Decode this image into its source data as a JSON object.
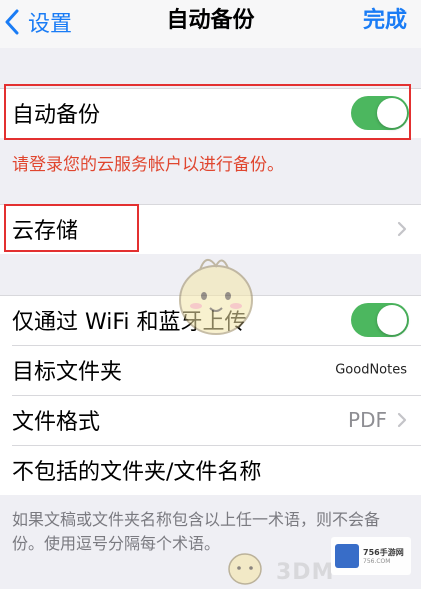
{
  "navbar": {
    "back_label": "设置",
    "title": "自动备份",
    "done_label": "完成"
  },
  "auto_backup": {
    "label": "自动备份",
    "toggle_on": true,
    "error_message": "请登录您的云服务帐户以进行备份。"
  },
  "cloud_storage": {
    "label": "云存储"
  },
  "options": {
    "wifi_bluetooth_label": "仅通过 WiFi 和蓝牙上传",
    "wifi_bluetooth_on": true,
    "target_folder_label": "目标文件夹",
    "target_folder_value": "GoodNotes",
    "file_format_label": "文件格式",
    "file_format_value": "PDF",
    "excluded_label": "不包括的文件夹/文件名称"
  },
  "footer_note": "如果文稿或文件夹名称包含以上任一术语，则不会备份。使用逗号分隔每个术语。",
  "watermark": {
    "brand_text": "756手游网",
    "brand_sub": "756.COM",
    "site_text": "3DM"
  },
  "colors": {
    "accent_blue": "#1a7cf5",
    "switch_green": "#4cb75f",
    "error_red": "#e0462f",
    "highlight_red": "#e33030",
    "background": "#efeff4"
  },
  "icons": {
    "back": "chevron-left-icon",
    "disclosure": "chevron-right-icon"
  }
}
